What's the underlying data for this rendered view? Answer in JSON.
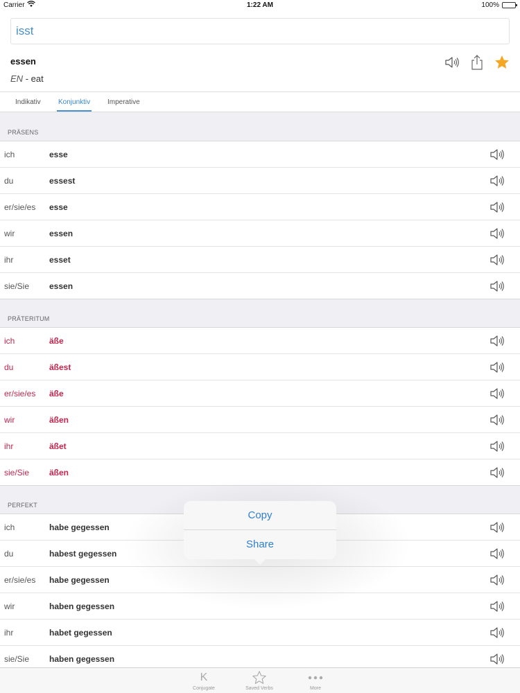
{
  "status_bar": {
    "carrier": "Carrier",
    "time": "1:22 AM",
    "battery": "100%"
  },
  "search": {
    "value": "isst",
    "placeholder": ""
  },
  "verb": {
    "infinitive": "essen",
    "lang": "EN",
    "separator": "-",
    "translation": "eat"
  },
  "tabs": [
    {
      "label": "Indikativ"
    },
    {
      "label": "Konjunktiv"
    },
    {
      "label": "Imperative"
    }
  ],
  "sections": [
    {
      "title": "PRÄSENS",
      "rows": [
        {
          "pronoun": "ich",
          "form": "esse"
        },
        {
          "pronoun": "du",
          "form": "essest"
        },
        {
          "pronoun": "er/sie/es",
          "form": "esse"
        },
        {
          "pronoun": "wir",
          "form": "essen"
        },
        {
          "pronoun": "ihr",
          "form": "esset"
        },
        {
          "pronoun": "sie/Sie",
          "form": "essen"
        }
      ]
    },
    {
      "title": "PRÄTERITUM",
      "rows": [
        {
          "pronoun": "ich",
          "form": "äße"
        },
        {
          "pronoun": "du",
          "form": "äßest"
        },
        {
          "pronoun": "er/sie/es",
          "form": "äße"
        },
        {
          "pronoun": "wir",
          "form": "äßen"
        },
        {
          "pronoun": "ihr",
          "form": "äßet"
        },
        {
          "pronoun": "sie/Sie",
          "form": "äßen"
        }
      ]
    },
    {
      "title": "PERFEKT",
      "rows": [
        {
          "pronoun": "ich",
          "form": "habe gegessen"
        },
        {
          "pronoun": "du",
          "form": "habest gegessen"
        },
        {
          "pronoun": "er/sie/es",
          "form": "habe gegessen"
        },
        {
          "pronoun": "wir",
          "form": "haben gegessen"
        },
        {
          "pronoun": "ihr",
          "form": "habet gegessen"
        },
        {
          "pronoun": "sie/Sie",
          "form": "haben gegessen"
        }
      ]
    }
  ],
  "popover": {
    "copy": "Copy",
    "share": "Share"
  },
  "tab_bar": {
    "conjugate_glyph": "K",
    "conjugate": "Conjugate",
    "saved": "Saved Verbs",
    "more": "More"
  },
  "colors": {
    "accent": "#3a86c9",
    "irregular": "#c4264d",
    "star": "#f5a623"
  },
  "icons": {
    "header": [
      "speaker-icon",
      "share-icon",
      "star-icon"
    ],
    "row": "speaker-icon",
    "tab_bar": [
      "k-icon",
      "star-outline-icon",
      "more-dots-icon"
    ]
  }
}
